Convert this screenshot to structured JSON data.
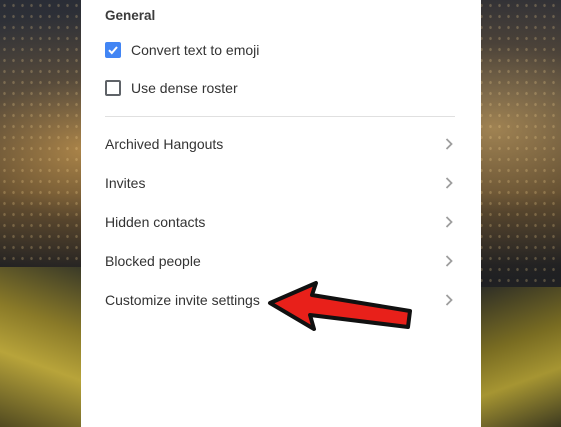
{
  "settings": {
    "section_title": "General",
    "options": [
      {
        "label": "Convert text to emoji",
        "checked": true
      },
      {
        "label": "Use dense roster",
        "checked": false
      }
    ],
    "menu": [
      {
        "label": "Archived Hangouts",
        "icon": "chevron-right-icon"
      },
      {
        "label": "Invites",
        "icon": "chevron-right-icon"
      },
      {
        "label": "Hidden contacts",
        "icon": "chevron-right-icon"
      },
      {
        "label": "Blocked people",
        "icon": "chevron-right-icon"
      },
      {
        "label": "Customize invite settings",
        "icon": "chevron-right-icon"
      }
    ]
  },
  "annotation": {
    "icon": "red-arrow-icon",
    "color": "#e8201a"
  },
  "colors": {
    "checkbox_accent": "#4285f4",
    "panel": "#ffffff"
  }
}
